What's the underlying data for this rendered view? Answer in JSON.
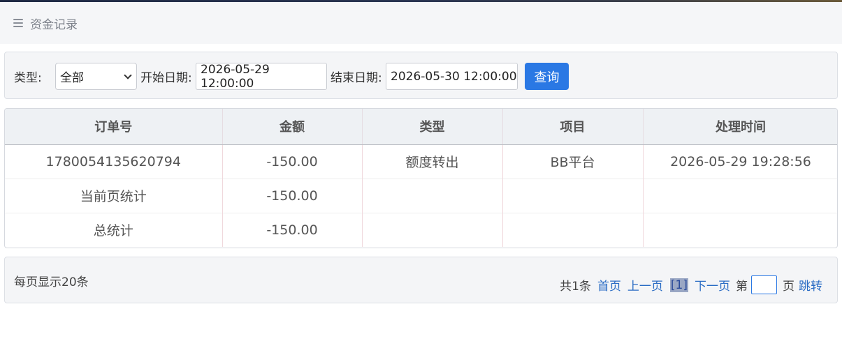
{
  "header": {
    "title": "资金记录"
  },
  "filters": {
    "type_label": "类型:",
    "type_value": "全部",
    "start_label": "开始日期:",
    "start_value": "2026-05-29 12:00:00",
    "end_label": "结束日期:",
    "end_value": "2026-05-30 12:00:00",
    "query_label": "查询"
  },
  "table": {
    "headers": [
      "订单号",
      "金额",
      "类型",
      "项目",
      "处理时间"
    ],
    "rows": [
      [
        "1780054135620794",
        "-150.00",
        "额度转出",
        "BB平台",
        "2026-05-29 19:28:56"
      ],
      [
        "当前页统计",
        "-150.00",
        "",
        "",
        ""
      ],
      [
        "总统计",
        "-150.00",
        "",
        "",
        ""
      ]
    ]
  },
  "pagination": {
    "per_page": "每页显示20条",
    "total": "共1条",
    "first": "首页",
    "prev": "上一页",
    "current": "[1]",
    "next": "下一页",
    "goto_prefix": "第",
    "goto_suffix": "页",
    "jump": "跳转"
  },
  "colors": {
    "primary": "#2a78e4",
    "link": "#2a6cc4"
  },
  "icons": {
    "menu": "menu-icon",
    "select": "chevron-down-icon"
  }
}
